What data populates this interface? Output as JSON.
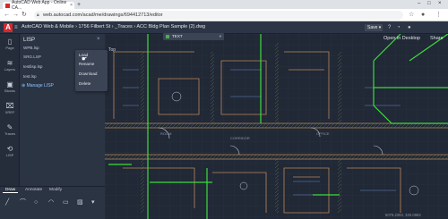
{
  "browser": {
    "tab_title": "AutoCAD Web App - Online CA...",
    "tab_close": "×",
    "new_tab": "+",
    "url": "web.autocad.com/acad/me/drawings/694412713/editor",
    "window_controls": [
      "–",
      "□",
      "×"
    ]
  },
  "header": {
    "logo": "A",
    "breadcrumb": "AutoCAD Web & Mobile  ›  1756 Filbert St  ›  _Traces  ›  ACC Bldg Plan Sample (2).dwg",
    "save_label": "Save",
    "open_desktop_label": "Open in Desktop",
    "share_label": "Share"
  },
  "rail": {
    "items": [
      {
        "icon": "page-icon",
        "glyph": "▯",
        "label": "Page"
      },
      {
        "icon": "layers-icon",
        "glyph": "≋",
        "label": "Layers"
      },
      {
        "icon": "blocks-icon",
        "glyph": "▣",
        "label": "Blocks"
      },
      {
        "icon": "xref-icon",
        "glyph": "⌧",
        "label": "XREF"
      },
      {
        "icon": "traces-icon",
        "glyph": "✎",
        "label": "Traces"
      },
      {
        "icon": "lisp-icon",
        "glyph": "⟲",
        "label": "LISP"
      }
    ]
  },
  "panel": {
    "title": "LISP",
    "close": "×",
    "files": [
      "WPB.lsp",
      "SRG.LSP",
      "testlisp.lsp",
      "test.lsp"
    ],
    "manage_label": "⊕ Manage LISP",
    "context_menu": [
      "Load",
      "Rename",
      "Download",
      "Delete"
    ]
  },
  "layer": {
    "color": "#4caf50",
    "name": "TEXT",
    "dropdown": "▾"
  },
  "canvas": {
    "view_label": "Top",
    "coords": "5079.2393, 320.0963"
  },
  "bottom_tools": {
    "tabs": [
      "Draw",
      "Annotate",
      "Modify"
    ],
    "icons": [
      {
        "name": "line-icon",
        "glyph": "╱"
      },
      {
        "name": "polyline-icon",
        "glyph": "⌒"
      },
      {
        "name": "circle-icon",
        "glyph": "○"
      },
      {
        "name": "arc-icon",
        "glyph": "◠"
      },
      {
        "name": "rectangle-icon",
        "glyph": "▭"
      },
      {
        "name": "hatch-icon",
        "glyph": "▨"
      },
      {
        "name": "more-icon",
        "glyph": "▾"
      }
    ]
  },
  "colors": {
    "accent": "#d6282c",
    "canvas_bg": "#212836",
    "green_line": "#3ddc3d",
    "wall_line": "#b9895a"
  }
}
